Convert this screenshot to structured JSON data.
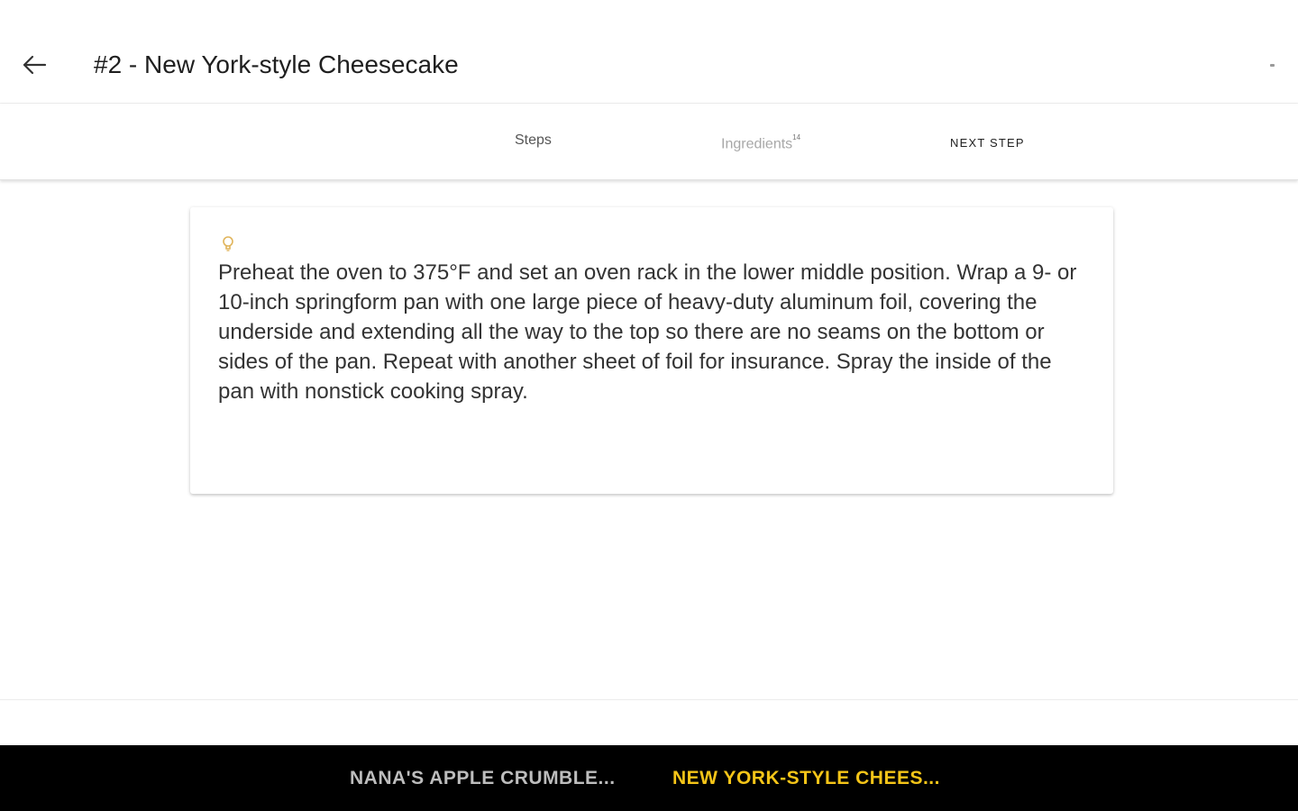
{
  "header": {
    "title": "#2 - New York-style Cheesecake",
    "back_icon": "arrow-left-icon",
    "menu_icon": "overflow-dot-icon"
  },
  "tabs": {
    "steps_label": "Steps",
    "ingredients_label": "Ingredients",
    "ingredients_count": "14",
    "next_label": "NEXT STEP"
  },
  "step": {
    "icon": "lightbulb-icon",
    "text": "Preheat the oven to 375°F and set an oven rack in the lower middle position. Wrap a 9- or 10-inch springform pan with one large piece of heavy-duty aluminum foil, covering the underside and extending all the way to the top so there are no seams on the bottom or sides of the pan. Repeat with another sheet of foil for insurance. Spray the inside of the pan with nonstick cooking spray."
  },
  "bottom_bar": {
    "recipes": [
      {
        "label": "NANA'S APPLE CRUMBLE...",
        "active": false
      },
      {
        "label": "NEW YORK-STYLE CHEES...",
        "active": true
      }
    ]
  },
  "colors": {
    "active_recipe": "#f5c518",
    "inactive_recipe": "#bdbdbd",
    "bottom_bar_bg": "#000000",
    "tip_icon": "#e8c878"
  }
}
